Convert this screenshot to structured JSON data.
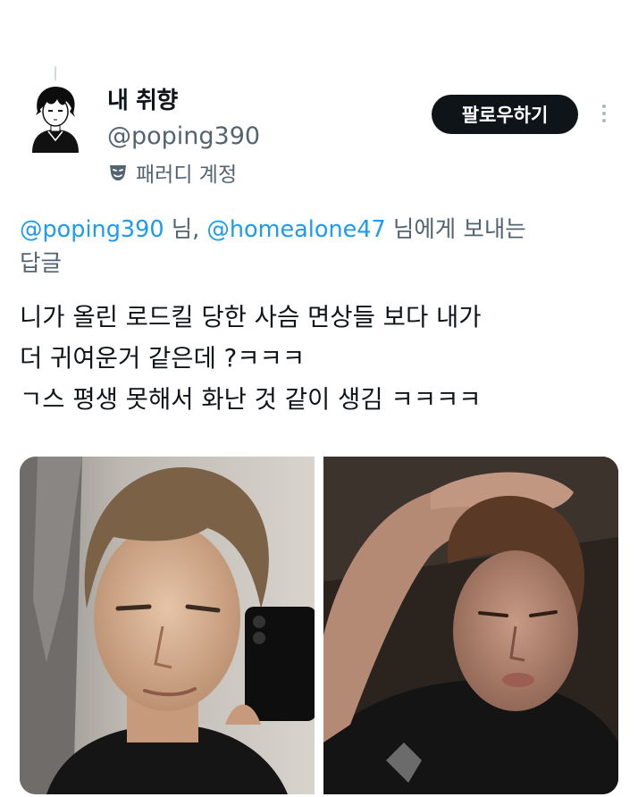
{
  "author": {
    "display_name": "내 취향",
    "handle": "@poping390",
    "parody_label": "패러디 계정",
    "avatar_icon": "anime-boy-avatar-icon",
    "parody_icon": "theater-mask-icon"
  },
  "follow_button": {
    "label": "팔로우하기"
  },
  "more_icon": "more-vertical-icon",
  "reply_context": {
    "mention1": "@poping390",
    "suffix1": " 님, ",
    "mention2": "@homealone47",
    "suffix2": " 님에게 보내는",
    "line2": "답글"
  },
  "tweet": {
    "lines": [
      "니가 올린 로드킬 당한 사슴 면상들 보다 내가",
      "더 귀여운거 같은데 ?ㅋㅋㅋ",
      "ㄱ스 평생 못해서 화난 것 같이 생김 ㅋㅋㅋㅋ"
    ]
  },
  "colors": {
    "link": "#1d9bf0",
    "secondary_text": "#536471",
    "button_bg": "#0f1419"
  }
}
